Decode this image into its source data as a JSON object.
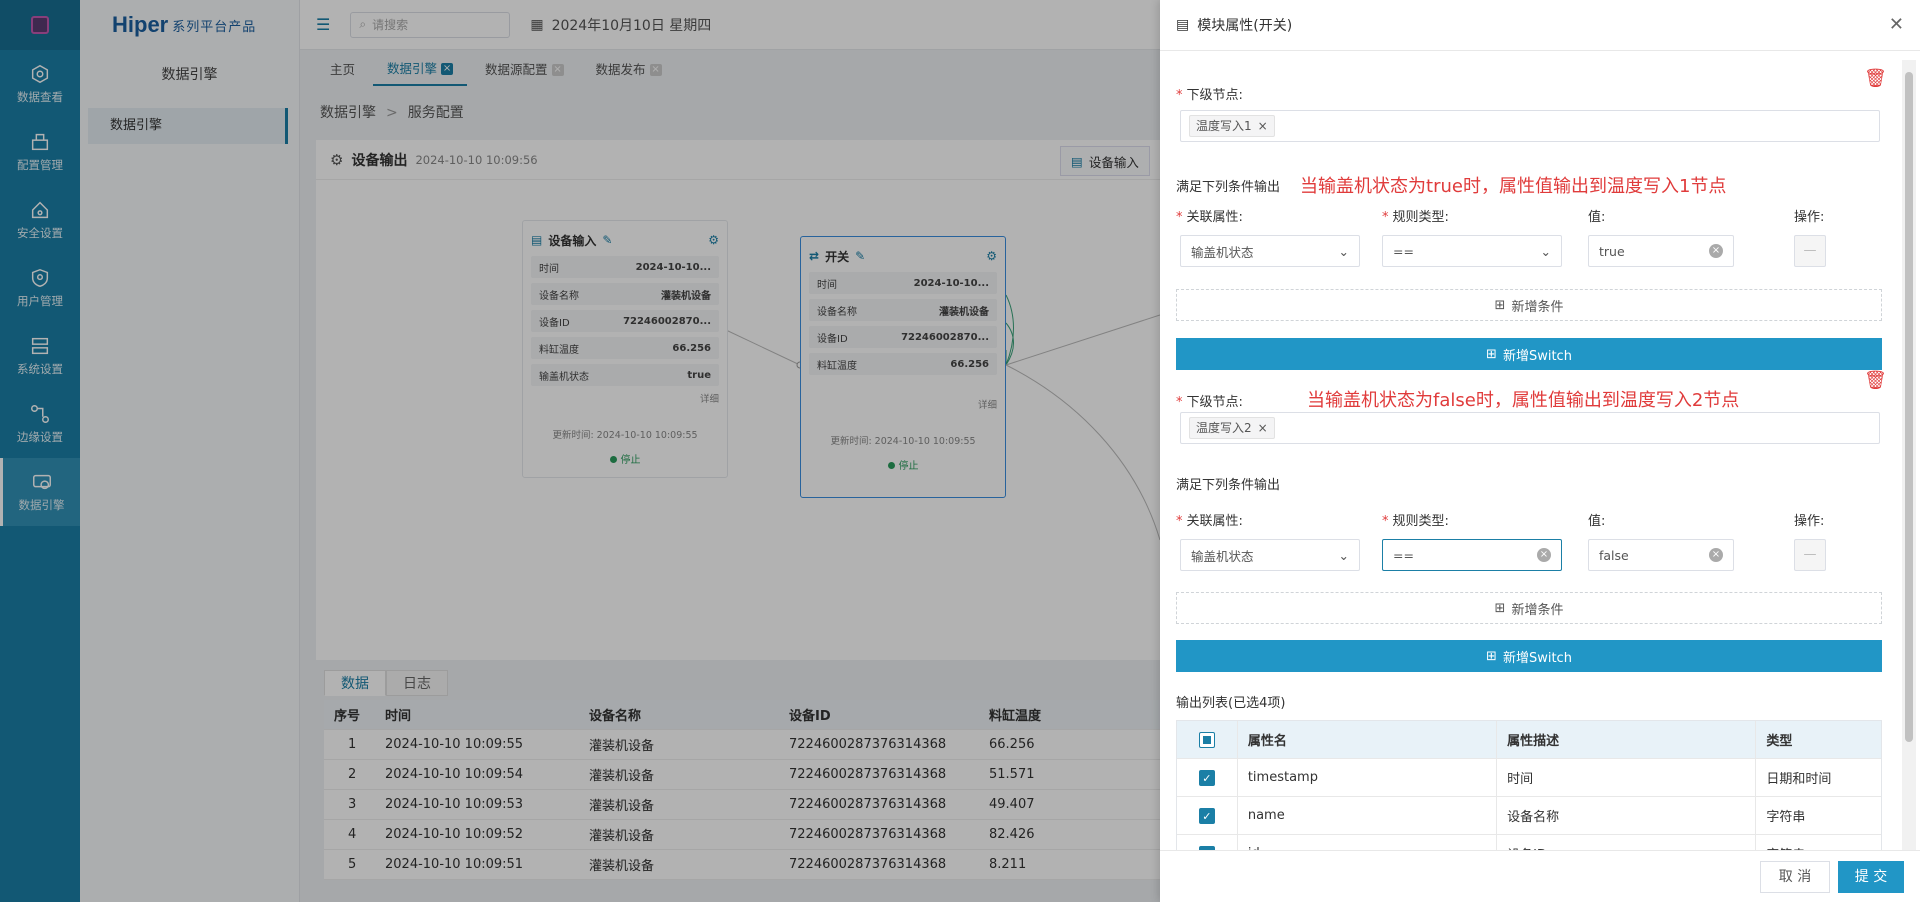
{
  "rail": {
    "items": [
      {
        "label": "数据查看",
        "icon": "view-icon"
      },
      {
        "label": "配置管理",
        "icon": "config-icon"
      },
      {
        "label": "安全设置",
        "icon": "security-icon"
      },
      {
        "label": "用户管理",
        "icon": "user-icon"
      },
      {
        "label": "系统设置",
        "icon": "system-icon"
      },
      {
        "label": "边缘设置",
        "icon": "edge-icon"
      },
      {
        "label": "数据引擎",
        "icon": "engine-icon"
      }
    ]
  },
  "brand": {
    "name": "Hiper",
    "suffix": "系列平台产品"
  },
  "subside": {
    "title": "数据引擎",
    "item": "数据引擎"
  },
  "header": {
    "search_placeholder": "请搜索",
    "date": "2024年10月10日 星期四"
  },
  "tabs": [
    {
      "label": "主页"
    },
    {
      "label": "数据引擎"
    },
    {
      "label": "数据源配置"
    },
    {
      "label": "数据发布"
    }
  ],
  "breadcrumb": {
    "a": "数据引擎",
    "sep": ">",
    "b": "服务配置"
  },
  "canvas": {
    "title": "设备输出",
    "timestamp": "2024-10-10 10:09:56",
    "device_input_btn": "设备输入"
  },
  "node_input": {
    "title": "设备输入",
    "rows": [
      {
        "k": "时间",
        "v": "2024-10-10..."
      },
      {
        "k": "设备名称",
        "v": "灌装机设备"
      },
      {
        "k": "设备ID",
        "v": "72246002870..."
      },
      {
        "k": "料缸温度",
        "v": "66.256"
      },
      {
        "k": "输盖机状态",
        "v": "true"
      }
    ],
    "detail": "详细",
    "updated": "更新时间: 2024-10-10 10:09:55",
    "status": "停止"
  },
  "node_switch": {
    "title": "开关",
    "rows": [
      {
        "k": "时间",
        "v": "2024-10-10..."
      },
      {
        "k": "设备名称",
        "v": "灌装机设备"
      },
      {
        "k": "设备ID",
        "v": "72246002870..."
      },
      {
        "k": "料缸温度",
        "v": "66.256"
      }
    ],
    "detail": "详细",
    "updated": "更新时间: 2024-10-10 10:09:55",
    "status": "停止"
  },
  "data_tabs": [
    "数据",
    "日志"
  ],
  "data_table": {
    "headers": [
      "序号",
      "时间",
      "设备名称",
      "设备ID",
      "料缸温度"
    ],
    "rows": [
      [
        "1",
        "2024-10-10 10:09:55",
        "灌装机设备",
        "7224600287376314368",
        "66.256"
      ],
      [
        "2",
        "2024-10-10 10:09:54",
        "灌装机设备",
        "7224600287376314368",
        "51.571"
      ],
      [
        "3",
        "2024-10-10 10:09:53",
        "灌装机设备",
        "7224600287376314368",
        "49.407"
      ],
      [
        "4",
        "2024-10-10 10:09:52",
        "灌装机设备",
        "7224600287376314368",
        "82.426"
      ],
      [
        "5",
        "2024-10-10 10:09:51",
        "灌装机设备",
        "7224600287376314368",
        "8.211"
      ]
    ]
  },
  "drawer": {
    "title": "模块属性(开关)",
    "next_node_label": "下级节点:",
    "cond_title": "满足下列条件输出",
    "assoc_label": "关联属性:",
    "rule_label": "规则类型:",
    "value_label": "值:",
    "op_label": "操作:",
    "add_cond": "新增条件",
    "add_switch": "新增Switch",
    "block1": {
      "tag": "温度写入1",
      "annotation": "当输盖机状态为true时，属性值输出到温度写入1节点",
      "assoc": "输盖机状态",
      "rule": "==",
      "value": "true"
    },
    "block2": {
      "tag": "温度写入2",
      "annotation": "当输盖机状态为false时，属性值输出到温度写入2节点",
      "assoc": "输盖机状态",
      "rule": "==",
      "value": "false"
    },
    "output_title": "输出列表(已选4项)",
    "output_headers": [
      "属性名",
      "属性描述",
      "类型"
    ],
    "output_rows": [
      [
        "timestamp",
        "时间",
        "日期和时间"
      ],
      [
        "name",
        "设备名称",
        "字符串"
      ],
      [
        "id",
        "设备ID",
        "字符串"
      ]
    ],
    "cancel": "取 消",
    "submit": "提 交"
  },
  "colors": {
    "accent": "#2196c6",
    "rail": "#1b7fa6",
    "annotation": "#e03b3b"
  }
}
